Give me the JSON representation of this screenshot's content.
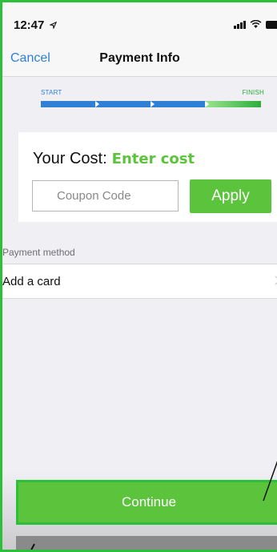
{
  "status_bar": {
    "time": "12:47",
    "location_icon": "location-arrow-icon",
    "signal_icon": "cellular-signal-icon",
    "wifi_icon": "wifi-icon",
    "battery_icon": "battery-icon"
  },
  "nav": {
    "cancel_label": "Cancel",
    "title": "Payment Info"
  },
  "progress": {
    "start_label": "START",
    "finish_label": "FINISH",
    "segments_total": 4,
    "segments_completed": 3
  },
  "cost": {
    "label": "Your Cost:",
    "value": "Enter cost"
  },
  "coupon": {
    "placeholder": "Coupon Code",
    "value": "",
    "apply_label": "Apply"
  },
  "payment_method": {
    "section_label": "Payment method",
    "add_card_label": "Add a card",
    "chevron_icon": "chevron-right-icon"
  },
  "footer": {
    "continue_label": "Continue"
  },
  "colors": {
    "accent_green": "#5cc43c",
    "border_green": "#2cbf3a",
    "ios_blue": "#2f7fd4",
    "background": "#efeff4"
  }
}
